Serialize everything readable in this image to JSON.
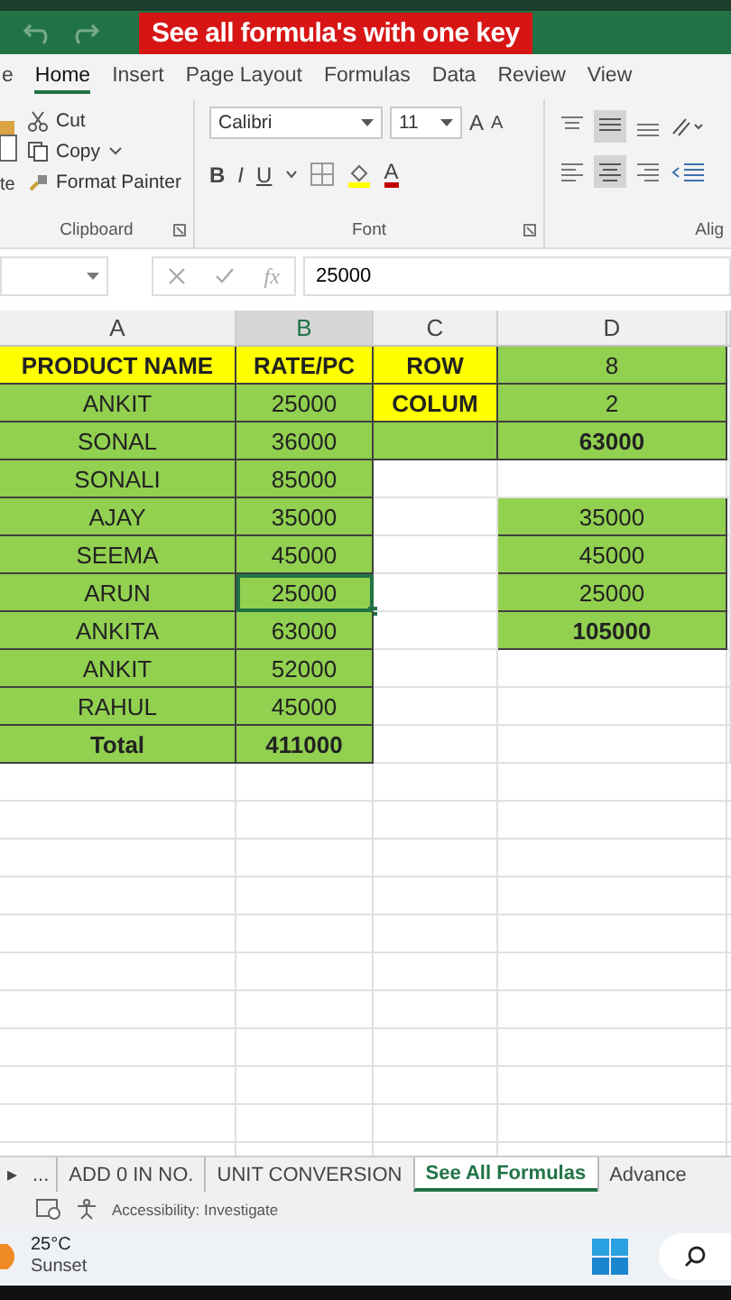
{
  "banner": "See all formula's with one key",
  "ribbon_tabs": [
    {
      "label": "e",
      "selected": false
    },
    {
      "label": "Home",
      "selected": true
    },
    {
      "label": "Insert",
      "selected": false
    },
    {
      "label": "Page Layout",
      "selected": false
    },
    {
      "label": "Formulas",
      "selected": false
    },
    {
      "label": "Data",
      "selected": false
    },
    {
      "label": "Review",
      "selected": false
    },
    {
      "label": "View",
      "selected": false
    }
  ],
  "clipboard": {
    "paste_label": "te",
    "cut": "Cut",
    "copy": "Copy",
    "format_painter": "Format Painter",
    "group_label": "Clipboard"
  },
  "font": {
    "name": "Calibri",
    "size": "11",
    "grow": "A",
    "shrink": "A",
    "bold": "B",
    "italic": "I",
    "underline": "U",
    "font_color": "A",
    "group_label": "Font"
  },
  "alignment": {
    "group_label": "Alig"
  },
  "formula_bar": {
    "value": "25000",
    "fx": "fx"
  },
  "columns": [
    {
      "label": "A",
      "selected": false
    },
    {
      "label": "B",
      "selected": true
    },
    {
      "label": "C",
      "selected": false
    },
    {
      "label": "D",
      "selected": false
    }
  ],
  "rows": [
    {
      "cells": [
        {
          "text": "PRODUCT NAME",
          "color": "#ffff00",
          "bold": true,
          "selected": false
        },
        {
          "text": "RATE/PC",
          "color": "#ffff00",
          "bold": true,
          "selected": false
        },
        {
          "text": "ROW",
          "color": "#ffff00",
          "bold": true,
          "selected": false
        },
        {
          "text": "8",
          "color": "#92d050",
          "bold": false,
          "selected": false
        }
      ]
    },
    {
      "cells": [
        {
          "text": "ANKIT",
          "color": "#92d050",
          "bold": false,
          "selected": false
        },
        {
          "text": "25000",
          "color": "#92d050",
          "bold": false,
          "selected": false
        },
        {
          "text": "COLUM",
          "color": "#ffff00",
          "bold": true,
          "selected": false
        },
        {
          "text": "2",
          "color": "#92d050",
          "bold": false,
          "selected": false
        }
      ]
    },
    {
      "cells": [
        {
          "text": "SONAL",
          "color": "#92d050",
          "bold": false,
          "selected": false
        },
        {
          "text": "36000",
          "color": "#92d050",
          "bold": false,
          "selected": false
        },
        {
          "color": "#92d050",
          "selected": false
        },
        {
          "text": "63000",
          "color": "#92d050",
          "bold": true,
          "selected": false
        }
      ]
    },
    {
      "cells": [
        {
          "text": "SONALI",
          "color": "#92d050",
          "bold": false,
          "selected": false
        },
        {
          "text": "85000",
          "color": "#92d050",
          "bold": false,
          "selected": false
        },
        {
          "selected": false
        },
        {
          "selected": false
        }
      ]
    },
    {
      "cells": [
        {
          "text": "AJAY",
          "color": "#92d050",
          "bold": false,
          "selected": false
        },
        {
          "text": "35000",
          "color": "#92d050",
          "bold": false,
          "selected": false
        },
        {
          "selected": false
        },
        {
          "text": "35000",
          "color": "#92d050",
          "bold": false,
          "selected": false
        }
      ]
    },
    {
      "cells": [
        {
          "text": "SEEMA",
          "color": "#92d050",
          "bold": false,
          "selected": false
        },
        {
          "text": "45000",
          "color": "#92d050",
          "bold": false,
          "selected": false
        },
        {
          "selected": false
        },
        {
          "text": "45000",
          "color": "#92d050",
          "bold": false,
          "selected": false
        }
      ]
    },
    {
      "cells": [
        {
          "text": "ARUN",
          "color": "#92d050",
          "bold": false,
          "selected": false
        },
        {
          "text": "25000",
          "color": "#92d050",
          "bold": false,
          "selected": true
        },
        {
          "selected": false
        },
        {
          "text": "25000",
          "color": "#92d050",
          "bold": false,
          "selected": false
        }
      ]
    },
    {
      "cells": [
        {
          "text": "ANKITA",
          "color": "#92d050",
          "bold": false,
          "selected": false
        },
        {
          "text": "63000",
          "color": "#92d050",
          "bold": false,
          "selected": false
        },
        {
          "selected": false
        },
        {
          "text": "105000",
          "color": "#92d050",
          "bold": true,
          "selected": false
        }
      ]
    },
    {
      "cells": [
        {
          "text": "ANKIT",
          "color": "#92d050",
          "bold": false,
          "selected": false
        },
        {
          "text": "52000",
          "color": "#92d050",
          "bold": false,
          "selected": false
        },
        {
          "selected": false
        },
        {
          "selected": false
        }
      ]
    },
    {
      "cells": [
        {
          "text": "RAHUL",
          "color": "#92d050",
          "bold": false,
          "selected": false
        },
        {
          "text": "45000",
          "color": "#92d050",
          "bold": false,
          "selected": false
        },
        {
          "selected": false
        },
        {
          "selected": false
        }
      ]
    },
    {
      "cells": [
        {
          "text": "Total",
          "color": "#92d050",
          "bold": true,
          "selected": false
        },
        {
          "text": "411000",
          "color": "#92d050",
          "bold": true,
          "selected": false
        },
        {
          "selected": false
        },
        {
          "selected": false
        }
      ]
    }
  ],
  "sheet_nav": {
    "next": "▸",
    "more": "..."
  },
  "sheet_tabs": [
    {
      "label": "ADD 0 IN NO.",
      "selected": false
    },
    {
      "label": "UNIT CONVERSION",
      "selected": false
    },
    {
      "label": "See All Formulas",
      "selected": true
    },
    {
      "label": "Advance",
      "selected": false
    }
  ],
  "status_bar": {
    "accessibility": "Accessibility: Investigate"
  },
  "taskbar": {
    "temperature": "25°C",
    "weather": "Sunset"
  }
}
